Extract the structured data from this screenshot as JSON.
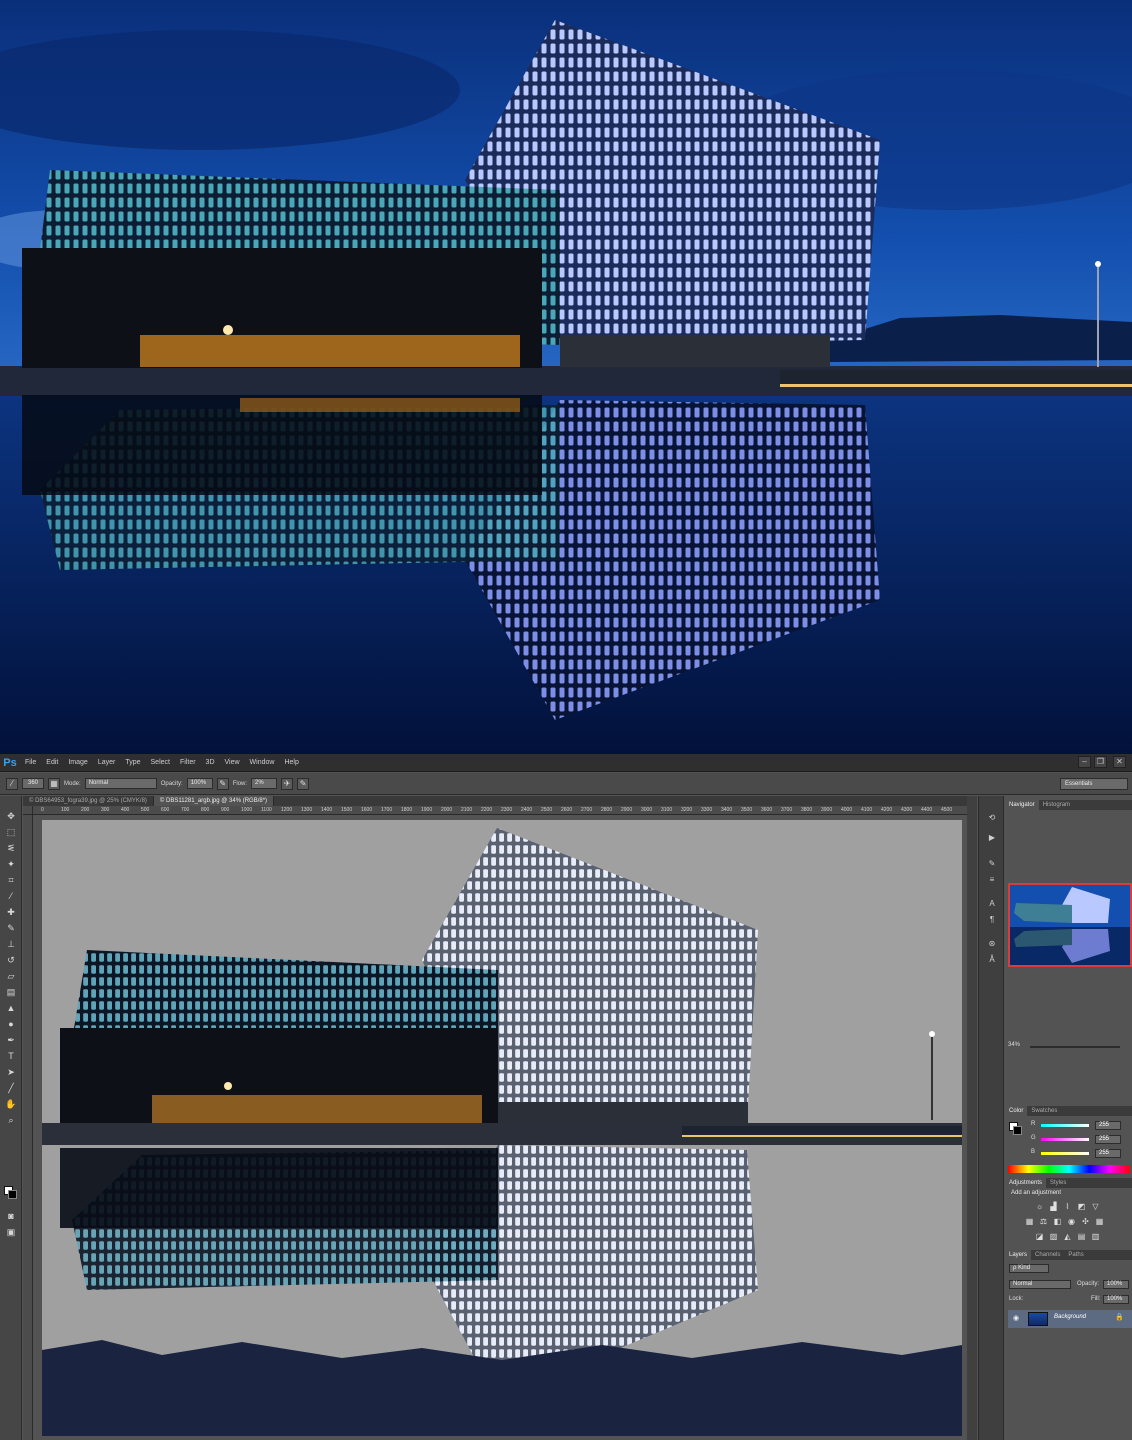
{
  "app": {
    "logo": "Ps"
  },
  "menu": [
    "File",
    "Edit",
    "Image",
    "Layer",
    "Type",
    "Select",
    "Filter",
    "3D",
    "View",
    "Window",
    "Help"
  ],
  "window_controls": [
    "–",
    "❐",
    "✕"
  ],
  "options": {
    "brush_size": "360",
    "mode_label": "Mode:",
    "mode_value": "Normal",
    "opacity_label": "Opacity:",
    "opacity_value": "100%",
    "flow_label": "Flow:",
    "flow_value": "2%",
    "workspace": "Essentials"
  },
  "doc_tabs": [
    {
      "label": "© DBS64953_fogra39.jpg @ 25% (CMYK/8)",
      "active": false
    },
    {
      "label": "© DBS11281_argb.jpg @ 34% (RGB/8*)",
      "active": true
    }
  ],
  "ruler_ticks": [
    "0",
    "100",
    "200",
    "300",
    "400",
    "500",
    "600",
    "700",
    "800",
    "900",
    "1000",
    "1100",
    "1200",
    "1300",
    "1400",
    "1500",
    "1600",
    "1700",
    "1800",
    "1900",
    "2000",
    "2100",
    "2200",
    "2300",
    "2400",
    "2500",
    "2600",
    "2700",
    "2800",
    "2900",
    "3000",
    "3100",
    "3200",
    "3300",
    "3400",
    "3500",
    "3600",
    "3700",
    "3800",
    "3900",
    "4000",
    "4100",
    "4200",
    "4300",
    "4400",
    "4500"
  ],
  "navigator": {
    "tabs": [
      "Navigator",
      "Histogram"
    ],
    "zoom": "34%"
  },
  "color_panel": {
    "tabs": [
      "Color",
      "Swatches"
    ],
    "channels": [
      {
        "label": "R",
        "value": "255",
        "color": "#ff6b6b"
      },
      {
        "label": "G",
        "value": "255",
        "color": "#6bff6b"
      },
      {
        "label": "B",
        "value": "255",
        "color": "#6b8bff"
      }
    ]
  },
  "adjustments": {
    "tabs": [
      "Adjustments",
      "Styles"
    ],
    "title": "Add an adjustment"
  },
  "layers": {
    "tabs": [
      "Layers",
      "Channels",
      "Paths"
    ],
    "kind_label": "ρ Kind",
    "blend": "Normal",
    "opacity_label": "Opacity:",
    "opacity_value": "100%",
    "lock_label": "Lock:",
    "fill_label": "Fill:",
    "fill_value": "100%",
    "layer_name": "Background"
  },
  "colors": {
    "sky": "#0b3a8c",
    "canvas_gray": "#a0a0a0",
    "ps_panel": "#535353",
    "accent_red": "#d93c3c"
  }
}
